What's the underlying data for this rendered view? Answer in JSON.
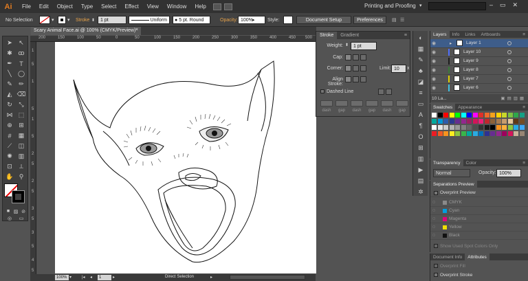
{
  "app": {
    "logo": "Ai",
    "menu": [
      "File",
      "Edit",
      "Object",
      "Type",
      "Select",
      "Effect",
      "View",
      "Window",
      "Help"
    ],
    "workspace": "Printing and Proofing",
    "window_buttons": [
      "–",
      "▭",
      "✕"
    ]
  },
  "control": {
    "selection": "No Selection",
    "stroke_label": "Stroke",
    "stroke_weight": "1 pt",
    "profile": "Uniform",
    "brush": "5 pt. Round",
    "opacity_label": "Opacity:",
    "opacity": "100%",
    "style_label": "Style:",
    "doc_setup": "Document Setup",
    "prefs": "Preferences"
  },
  "document": {
    "tab_title": "Scary Animal Face.ai @ 100% (CMYK/Preview)",
    "tab_close": "×"
  },
  "rulers": {
    "top": [
      "200",
      "150",
      "100",
      "50",
      "0",
      "50",
      "100",
      "150",
      "200",
      "250",
      "300",
      "350",
      "400",
      "450",
      "500"
    ],
    "left": [
      "1",
      "5",
      "1",
      "5",
      "1",
      "5",
      "2",
      "5",
      "2",
      "5",
      "3",
      "5",
      "3",
      "5",
      "4",
      "5"
    ]
  },
  "status": {
    "zoom": "100%",
    "page": "1",
    "tool": "Direct Selection"
  },
  "stroke_panel": {
    "tabs": [
      "Stroke",
      "Gradient"
    ],
    "weight_label": "Weight:",
    "weight": "1 pt",
    "cap_label": "Cap:",
    "corner_label": "Corner:",
    "limit_label": "Limit:",
    "limit": "10",
    "limit_unit": "x",
    "align_label": "Align Stroke:",
    "dashed": "Dashed Line",
    "dash_labels": [
      "dash",
      "gap",
      "dash",
      "gap",
      "dash",
      "gap"
    ]
  },
  "layers_panel": {
    "tabs": [
      "Layers",
      "Info",
      "Links",
      "Artboards"
    ],
    "layers": [
      {
        "name": "Layer 1",
        "color": "#4f6fff"
      },
      {
        "name": "Layer 10",
        "color": "#4f6fff"
      },
      {
        "name": "Layer 9",
        "color": "#1f1f1f"
      },
      {
        "name": "Layer 8",
        "color": "#3a7a3a"
      },
      {
        "name": "Layer 7",
        "color": "#e0d000"
      },
      {
        "name": "Layer 6",
        "color": "#3fc0e0"
      }
    ],
    "footer": "10 La..."
  },
  "swatches_panel": {
    "tabs": [
      "Swatches",
      "Appearance"
    ]
  },
  "transparency_panel": {
    "tabs": [
      "Transparency",
      "Color"
    ],
    "mode": "Normal",
    "opacity_label": "Opacity:",
    "opacity": "100%"
  },
  "separations_panel": {
    "title": "Separations Preview",
    "overprint": "Overprint Preview",
    "plates": [
      {
        "name": "CMYK",
        "color": "#8a8a8a"
      },
      {
        "name": "Cyan",
        "color": "#00a0e0"
      },
      {
        "name": "Magenta",
        "color": "#e0007a"
      },
      {
        "name": "Yellow",
        "color": "#f0e000"
      },
      {
        "name": "Black",
        "color": "#111111"
      }
    ],
    "spot_only": "Show Used Spot Colors Only"
  },
  "doc_info_panel": {
    "tabs": [
      "Document Info",
      "Attributes"
    ],
    "overprint_fill": "Overprint Fill",
    "overprint_stroke": "Overprint Stroke"
  }
}
